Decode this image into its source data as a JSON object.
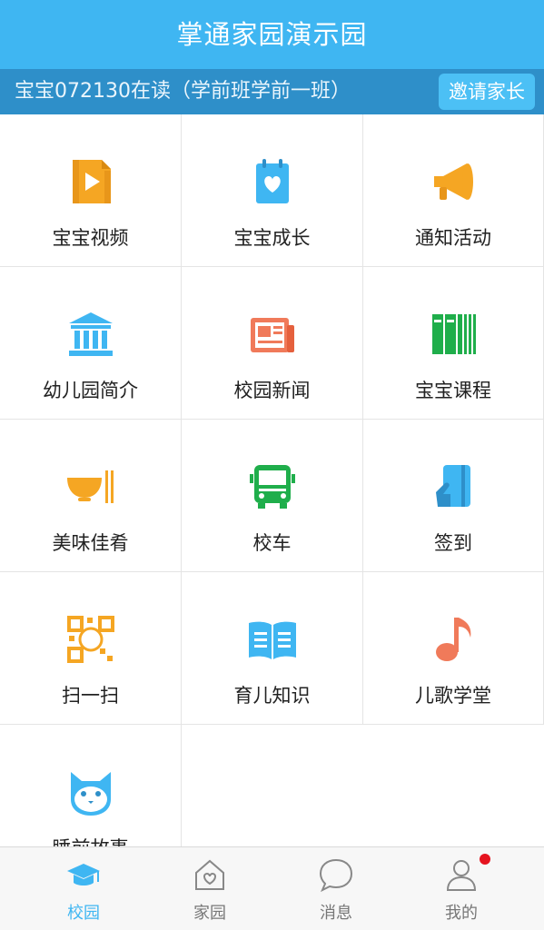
{
  "header": {
    "title": "掌通家园演示园"
  },
  "subheader": {
    "child_info": "宝宝072130在读（学前班学前一班）",
    "invite_label": "邀请家长"
  },
  "features": [
    {
      "label": "宝宝视频",
      "icon": "video-icon",
      "color": "#f5a623"
    },
    {
      "label": "宝宝成长",
      "icon": "growth-notebook-icon",
      "color": "#3fb6f2"
    },
    {
      "label": "通知活动",
      "icon": "megaphone-icon",
      "color": "#f5a623"
    },
    {
      "label": "幼儿园简介",
      "icon": "school-building-icon",
      "color": "#3fb6f2"
    },
    {
      "label": "校园新闻",
      "icon": "newspaper-icon",
      "color": "#f07a5a"
    },
    {
      "label": "宝宝课程",
      "icon": "books-icon",
      "color": "#1fae4b"
    },
    {
      "label": "美味佳肴",
      "icon": "bowl-chopsticks-icon",
      "color": "#f5a623"
    },
    {
      "label": "校车",
      "icon": "bus-icon",
      "color": "#1fae4b"
    },
    {
      "label": "签到",
      "icon": "card-swipe-icon",
      "color": "#3fb6f2"
    },
    {
      "label": "扫一扫",
      "icon": "qr-scan-icon",
      "color": "#f5a623"
    },
    {
      "label": "育儿知识",
      "icon": "open-book-icon",
      "color": "#3fb6f2"
    },
    {
      "label": "儿歌学堂",
      "icon": "music-note-icon",
      "color": "#f07a5a"
    },
    {
      "label": "睡前故事",
      "icon": "cat-icon",
      "color": "#3fb6f2"
    }
  ],
  "tabbar": {
    "tabs": [
      {
        "label": "校园",
        "icon": "graduation-cap-icon",
        "active": true
      },
      {
        "label": "家园",
        "icon": "home-heart-icon",
        "active": false
      },
      {
        "label": "消息",
        "icon": "chat-bubble-icon",
        "active": false
      },
      {
        "label": "我的",
        "icon": "person-icon",
        "active": false
      }
    ]
  },
  "colors": {
    "primary": "#3fb6f2",
    "subheader": "#2e8fc9",
    "badge": "#e5141f"
  }
}
